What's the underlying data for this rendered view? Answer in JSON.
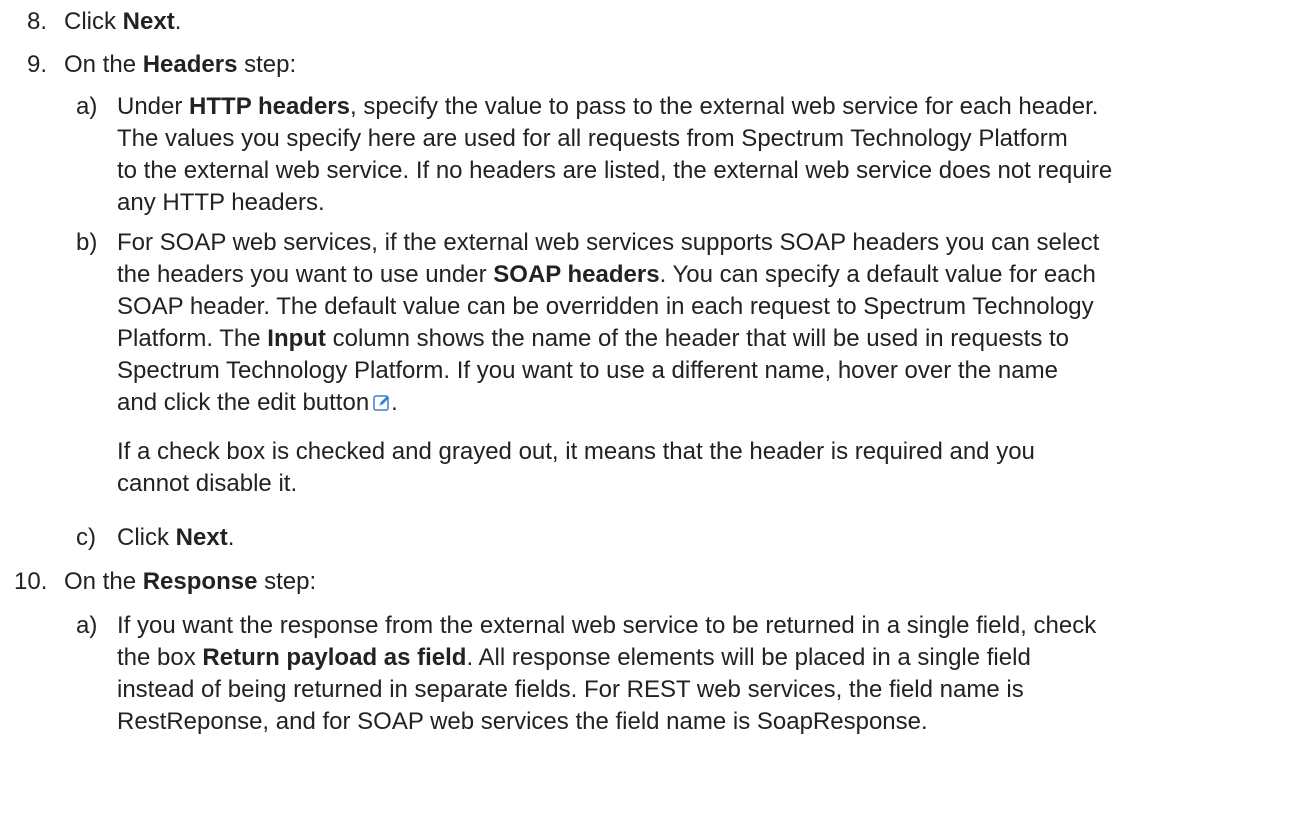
{
  "step8": {
    "number": "8.",
    "prefix": "Click ",
    "bold": "Next",
    "suffix": "."
  },
  "step9": {
    "number": "9.",
    "prefix": "On the ",
    "bold": "Headers",
    "suffix": " step:",
    "a": {
      "letter": "a)",
      "l1_prefix": "Under ",
      "l1_bold": "HTTP headers",
      "l1_suffix": ", specify the value to pass to the external web service for each header.",
      "l2": "The values you specify here are used for all requests from Spectrum Technology Platform",
      "l3": "to the external web service. If no headers are listed, the external web service does not require",
      "l4": "any HTTP headers."
    },
    "b": {
      "letter": "b)",
      "l1": "For SOAP web services, if the external web services supports SOAP headers you can select",
      "l2_prefix": "the headers you want to use under ",
      "l2_bold": "SOAP headers",
      "l2_suffix": ". You can specify a default value for each",
      "l3": "SOAP header. The default value can be overridden in each request to Spectrum Technology",
      "l4_prefix": "Platform. The ",
      "l4_bold": "Input",
      "l4_suffix": " column shows the name of the header that will be used in requests to",
      "l5": "Spectrum Technology Platform. If you want to use a different name, hover over the name",
      "l6_prefix": "and click the edit button",
      "l6_suffix": ".",
      "edit_icon": "edit-icon",
      "note_l1": "If a check box is checked and grayed out, it means that the header is required and you",
      "note_l2": "cannot disable it."
    },
    "c": {
      "letter": "c)",
      "prefix": "Click ",
      "bold": "Next",
      "suffix": "."
    }
  },
  "step10": {
    "number": "10.",
    "prefix": "On the ",
    "bold": "Response",
    "suffix": " step:",
    "a": {
      "letter": "a)",
      "l1": "If you want the response from the external web service to be returned in a single field, check",
      "l2_prefix": "the box ",
      "l2_bold": "Return payload as field",
      "l2_suffix": ". All response elements will be placed in a single field",
      "l3": "instead of being returned in separate fields. For REST web services, the field name is",
      "l4": "RestReponse, and for SOAP web services the field name is SoapResponse."
    }
  },
  "colors": {
    "text": "#222222",
    "icon_blue": "#3b7fd4"
  }
}
